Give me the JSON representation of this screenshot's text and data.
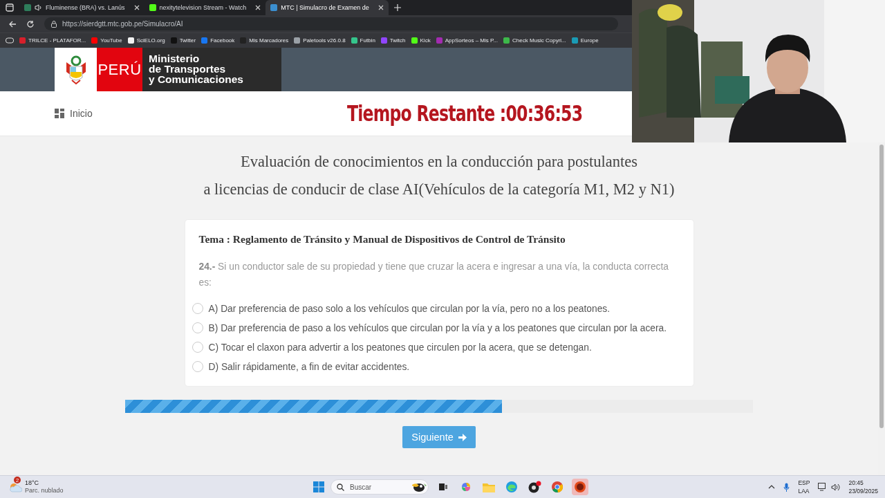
{
  "browser": {
    "tabs": [
      {
        "title": "Fluminense (BRA) vs. Lanús",
        "selected": false,
        "audio": true,
        "color": "#2e7d5b"
      },
      {
        "title": "nexitytelevision Stream - Watch",
        "selected": false,
        "audio": false,
        "color": "#53fc18"
      },
      {
        "title": "MTC | Simulacro de Examen de",
        "selected": true,
        "audio": false,
        "color": "#3b8fd0"
      }
    ],
    "address": "https://sierdgtt.mtc.gob.pe/Simulacro/AI",
    "bookmarks": [
      {
        "label": "TRILCE - PLATAFOR...",
        "color": "#d71f2b"
      },
      {
        "label": "YouTube",
        "color": "#ff0000"
      },
      {
        "label": "SciELO.org",
        "color": "#f2f2f2"
      },
      {
        "label": "Twitter",
        "color": "#111111"
      },
      {
        "label": "Facebook",
        "color": "#1877f2"
      },
      {
        "label": "Mis Marcadores",
        "color": "#222222"
      },
      {
        "label": "Paletools v26.0.8",
        "color": "#9aa0a6"
      },
      {
        "label": "Futbin",
        "color": "#35c58c"
      },
      {
        "label": "Twitch",
        "color": "#9146ff"
      },
      {
        "label": "Kick",
        "color": "#53fc18"
      },
      {
        "label": "AppSorteos – Mis P...",
        "color": "#a22bb0"
      },
      {
        "label": "Check Music Copyri...",
        "color": "#3db84a"
      },
      {
        "label": "Europe",
        "color": "#1a9bb5"
      }
    ]
  },
  "header": {
    "country": "PERÚ",
    "ministry": [
      "Ministerio",
      "de Transportes",
      "y Comunicaciones"
    ]
  },
  "nav": {
    "home": "Inicio",
    "timer": "Tiempo Restante :00:36:53"
  },
  "title_lines": [
    "Evaluación de conocimientos en la conducción para postulantes",
    "a licencias de conducir de clase AI(Vehículos de la categoría M1, M2 y N1)"
  ],
  "question": {
    "topic": "Tema : Reglamento de Tránsito y Manual de Dispositivos de Control de Tránsito",
    "text": "**24.-** Si un conductor sale de su propiedad y tiene que cruzar la acera e ingresar a una vía, la conducta correcta es:",
    "options": [
      {
        "label": "A) Dar preferencia de paso solo a los vehículos que circulan por la vía, pero no a los peatones.",
        "selected": false
      },
      {
        "label": "B) Dar preferencia de paso a los vehículos que circulan por la vía y a los peatones que circulan por la acera.",
        "selected": false
      },
      {
        "label": "C) Tocar el claxon para advertir a los peatones que circulen por la acera, que se detengan.",
        "selected": false
      },
      {
        "label": "D) Salir rápidamente, a fin de evitar accidentes.",
        "selected": false
      }
    ]
  },
  "progress": {
    "level": 0.6
  },
  "next_button": "Siguiente",
  "webcam": {
    "kind": "picture"
  },
  "taskbar": {
    "temperature": "18°C",
    "weather": "Parc. nublado",
    "weather_badge": "2",
    "search_placeholder": "Buscar",
    "language": [
      "ESP",
      "LAA"
    ],
    "time": "20:45",
    "date": "23/09/2025"
  }
}
